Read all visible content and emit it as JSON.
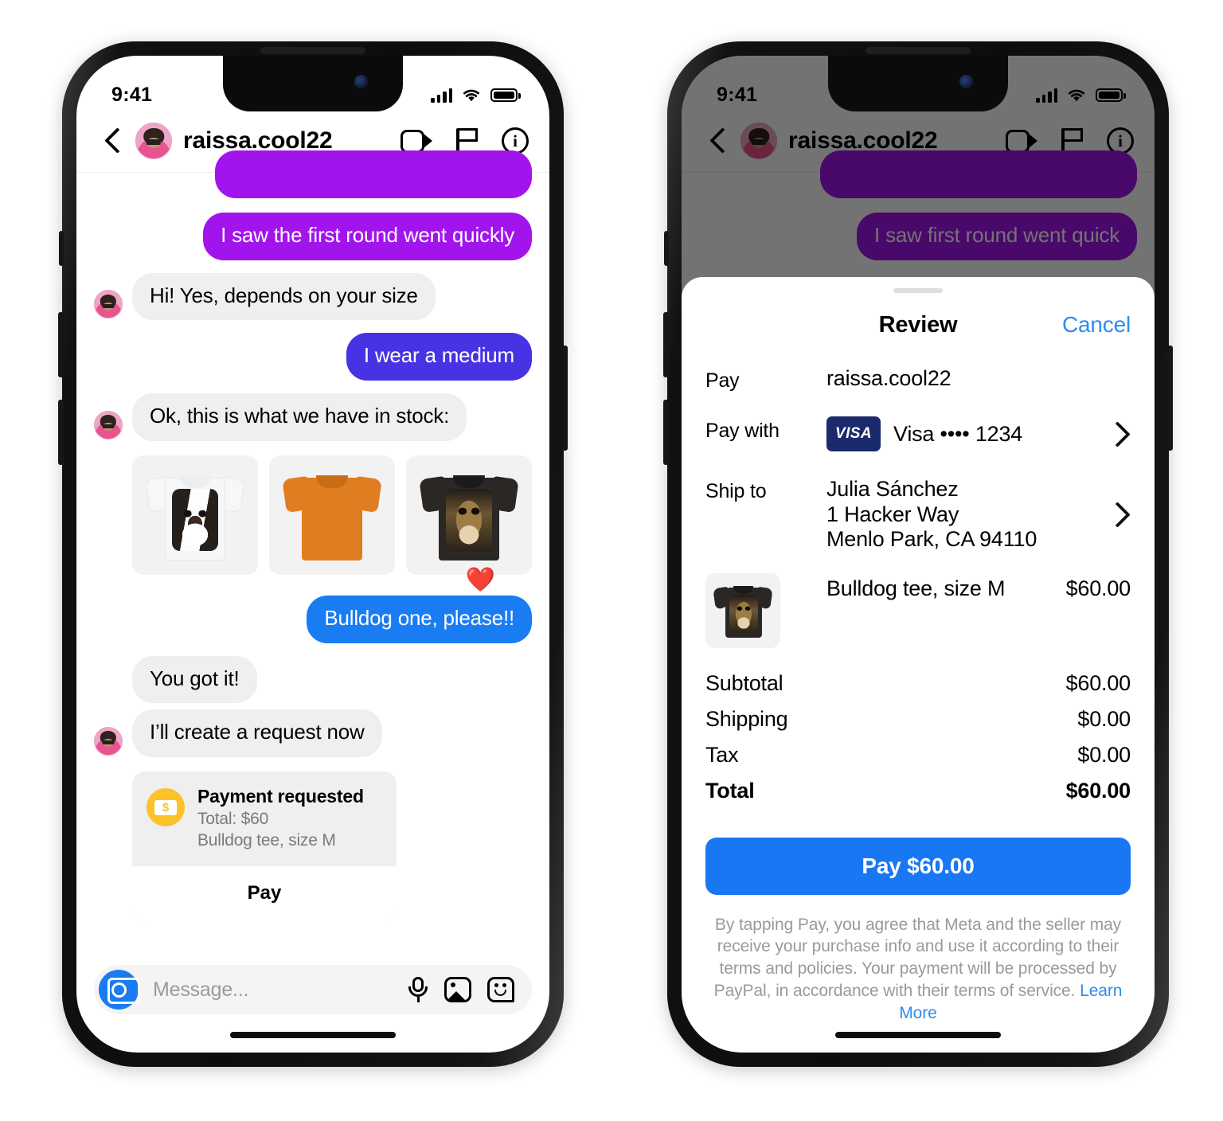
{
  "status_bar": {
    "time": "9:41",
    "signal_icon": "cellular-bars-icon",
    "wifi_icon": "wifi-icon",
    "battery_icon": "battery-full-icon"
  },
  "chat": {
    "header": {
      "back_icon": "back-chevron-icon",
      "avatar_alt": "raissa-avatar",
      "username": "raissa.cool22",
      "video_icon": "video-camera-icon",
      "flag_icon": "flag-icon",
      "info_icon": "info-circle-icon"
    },
    "messages": [
      {
        "text": "I saw the first round went quickly",
        "side": "out",
        "style": "purple"
      },
      {
        "text": "Hi! Yes, depends on your size",
        "side": "in",
        "avatar": true
      },
      {
        "text": "I wear a medium",
        "side": "out",
        "style": "violet"
      },
      {
        "text": "Ok, this is what we have in stock:",
        "side": "in",
        "avatar": true
      },
      {
        "text": "Bulldog one, please!!",
        "side": "out",
        "style": "blue"
      },
      {
        "text": "You got it!",
        "side": "in",
        "avatar": false
      },
      {
        "text": "I’ll create a request now",
        "side": "in",
        "avatar": true
      }
    ],
    "products": [
      {
        "name": "border-collie-white-tee",
        "color": "white"
      },
      {
        "name": "golden-retriever-orange-tee",
        "color": "orange"
      },
      {
        "name": "bulldog-black-tee",
        "color": "black"
      }
    ],
    "reaction": {
      "emoji": "❤️",
      "name": "heart-reaction"
    },
    "payment_card": {
      "icon": "money-coin-icon",
      "title": "Payment requested",
      "total_line": "Total: $60",
      "item_line": "Bulldog tee, size M",
      "button_label": "Pay"
    },
    "composer": {
      "camera_icon": "camera-icon",
      "placeholder": "Message...",
      "mic_icon": "microphone-icon",
      "gallery_icon": "photo-icon",
      "sticker_icon": "sticker-icon"
    }
  },
  "review_phone": {
    "dimmed_bubble": "I saw first round went quick",
    "sheet": {
      "grabber": "sheet-grabber",
      "title": "Review",
      "cancel_label": "Cancel",
      "pay_label": "Pay",
      "pay_value": "raissa.cool22",
      "pay_with_label": "Pay with",
      "card_brand_badge": "VISA",
      "card_value": "Visa •••• 1234",
      "ship_to_label": "Ship to",
      "ship_to_name": "Julia Sánchez",
      "ship_to_street": "1 Hacker Way",
      "ship_to_city": "Menlo Park, CA 94110",
      "item_name": "Bulldog tee, size M",
      "item_price": "$60.00",
      "totals": [
        {
          "label": "Subtotal",
          "value": "$60.00",
          "bold": false
        },
        {
          "label": "Shipping",
          "value": "$0.00",
          "bold": false
        },
        {
          "label": "Tax",
          "value": "$0.00",
          "bold": false
        },
        {
          "label": "Total",
          "value": "$60.00",
          "bold": true
        }
      ],
      "pay_button_label": "Pay $60.00",
      "legal_text": "By tapping Pay, you agree that Meta and the seller may receive your purchase info and use it according to their terms and policies. Your payment will be processed by PayPal, in accordance with their terms of service.",
      "learn_more_label": "Learn More",
      "chevron_icon": "chevron-right-icon"
    }
  },
  "colors": {
    "purple_bubble": "#a214ec",
    "violet_bubble": "#4733e3",
    "blue_bubble": "#1a7cf2",
    "incoming_bubble": "#efefef",
    "accent_link": "#2e8bf0",
    "pay_button": "#1877f2",
    "coin_yellow": "#fcc22a",
    "visa_navy": "#1a2a6c"
  }
}
